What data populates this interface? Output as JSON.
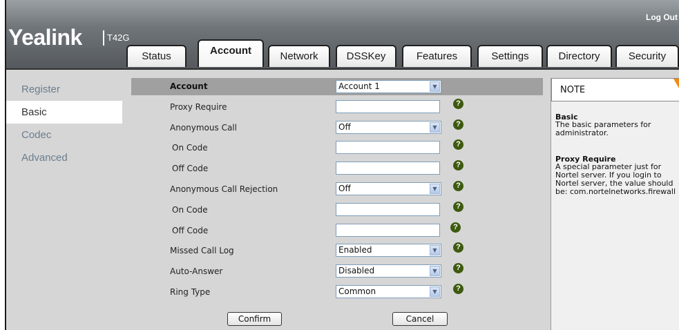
{
  "header": {
    "logout": "Log Out",
    "logo": "Yealink",
    "model": "T42G"
  },
  "tabs": [
    {
      "label": "Status"
    },
    {
      "label": "Account",
      "active": true
    },
    {
      "label": "Network"
    },
    {
      "label": "DSSKey"
    },
    {
      "label": "Features"
    },
    {
      "label": "Settings"
    },
    {
      "label": "Directory"
    },
    {
      "label": "Security"
    }
  ],
  "sidebar": {
    "items": [
      {
        "label": "Register"
      },
      {
        "label": "Basic",
        "active": true
      },
      {
        "label": "Codec"
      },
      {
        "label": "Advanced"
      }
    ]
  },
  "form": {
    "account_label": "Account",
    "account_value": "Account 1",
    "rows": [
      {
        "label": "Proxy Require",
        "type": "input",
        "value": ""
      },
      {
        "label": "Anonymous Call",
        "type": "select",
        "value": "Off"
      },
      {
        "label": "On Code",
        "type": "input",
        "value": ""
      },
      {
        "label": "Off Code",
        "type": "input",
        "value": ""
      },
      {
        "label": "Anonymous Call Rejection",
        "type": "select",
        "value": "Off"
      },
      {
        "label": "On Code",
        "type": "input",
        "value": ""
      },
      {
        "label": "Off Code",
        "type": "input",
        "value": ""
      },
      {
        "label": "Missed Call Log",
        "type": "select",
        "value": "Enabled"
      },
      {
        "label": "Auto-Answer",
        "type": "select",
        "value": "Disabled"
      },
      {
        "label": "Ring Type",
        "type": "select",
        "value": "Common"
      }
    ],
    "help_glyph": "?",
    "confirm": "Confirm",
    "cancel": "Cancel"
  },
  "note": {
    "title": "NOTE",
    "sections": [
      {
        "heading": "Basic",
        "lines": [
          "The basic parameters for",
          "administrator."
        ]
      },
      {
        "heading": "Proxy Require",
        "lines": [
          "A special parameter just for",
          "Nortel server. If you login to",
          "Nortel server, the value should",
          "be: com.nortelnetworks.firewall"
        ]
      }
    ]
  },
  "colors": {
    "header_dark": "#55595d",
    "help_icon": "#3d5a0f",
    "sidebar_text": "#6b7d8f",
    "note_accent": "#f08a16"
  }
}
